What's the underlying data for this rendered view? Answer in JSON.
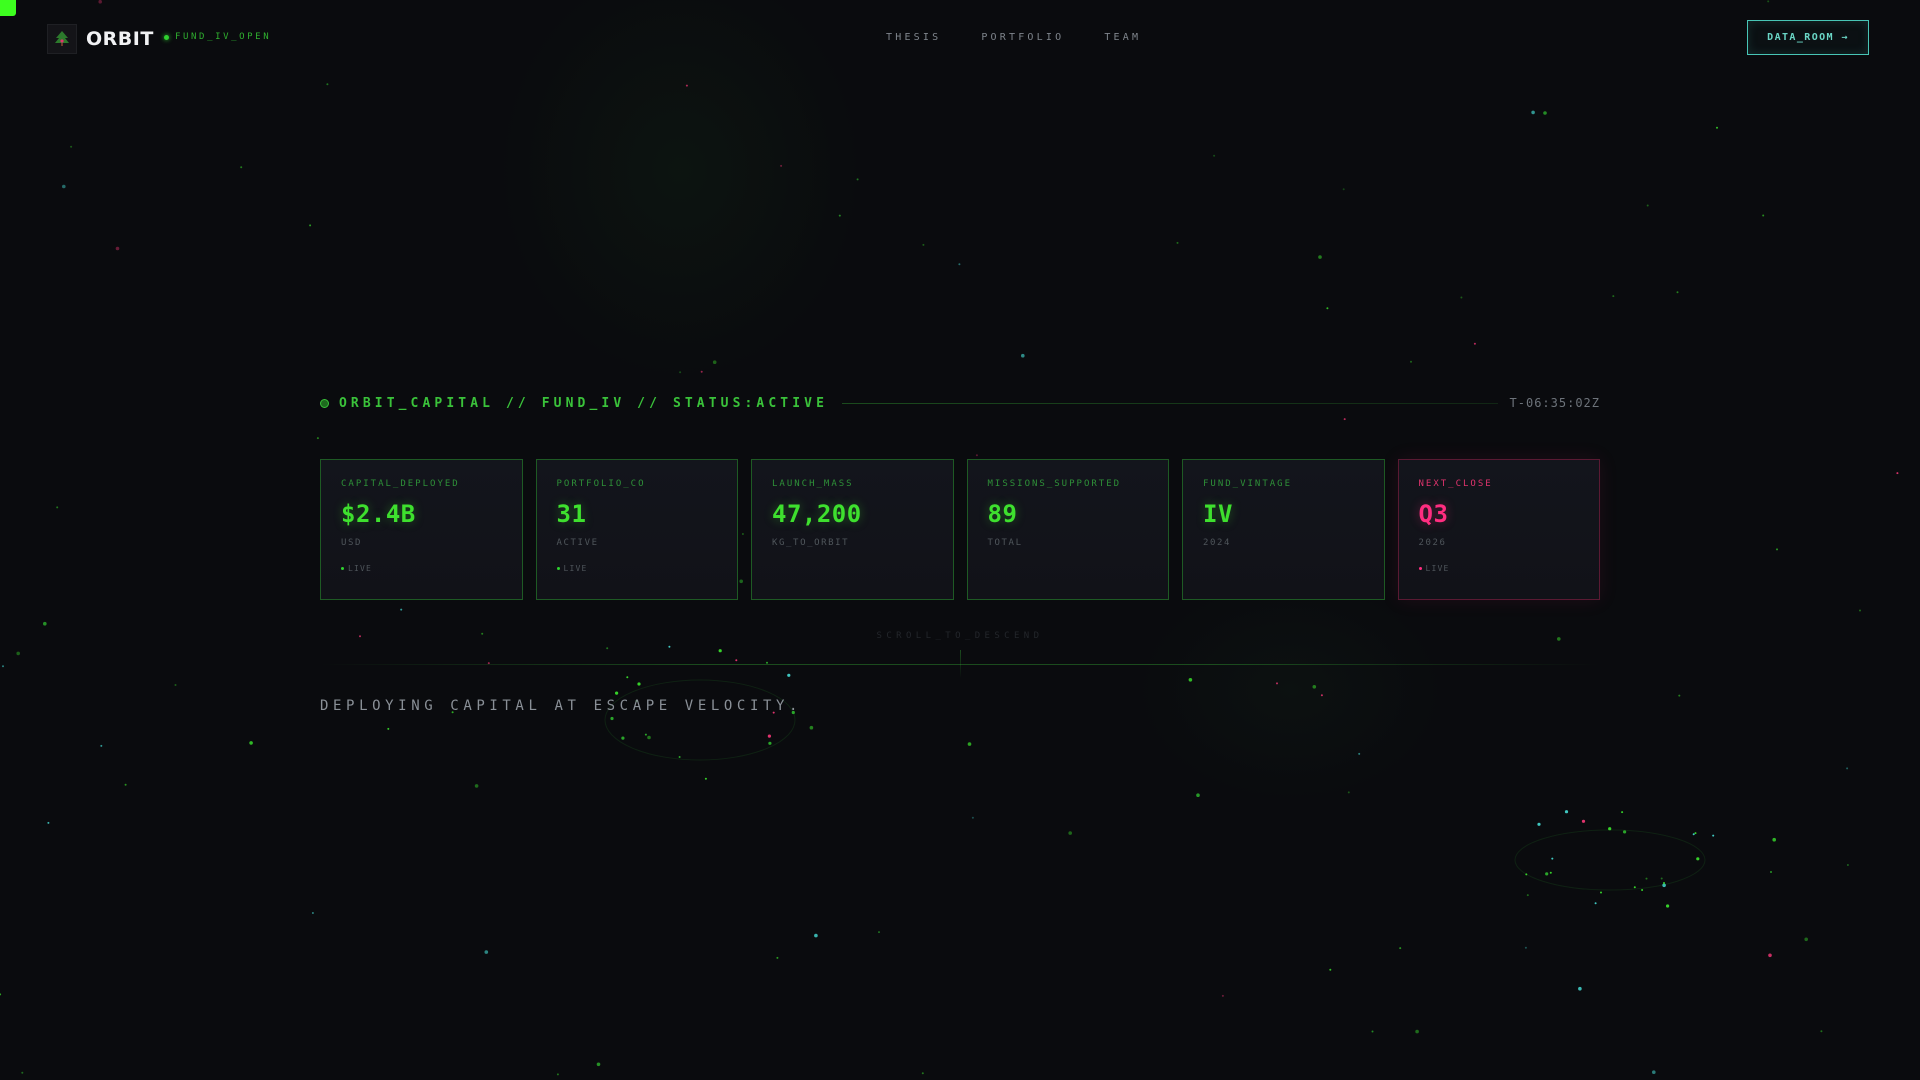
{
  "header": {
    "logo_text": "ORBIT",
    "fund_status": "FUND_IV_OPEN",
    "nav": [
      {
        "label": "THESIS"
      },
      {
        "label": "PORTFOLIO"
      },
      {
        "label": "TEAM"
      }
    ],
    "cta_label": "DATA_ROOM →"
  },
  "status_bar": {
    "text": "ORBIT_CAPITAL // FUND_IV // STATUS:ACTIVE",
    "timestamp": "T-06:35:02Z"
  },
  "stats": [
    {
      "label": "CAPITAL_DEPLOYED",
      "value": "$2.4B",
      "sub": "USD",
      "live": "LIVE"
    },
    {
      "label": "PORTFOLIO_CO",
      "value": "31",
      "sub": "ACTIVE",
      "live": "LIVE"
    },
    {
      "label": "LAUNCH_MASS",
      "value": "47,200",
      "sub": "KG_TO_ORBIT",
      "live": ""
    },
    {
      "label": "MISSIONS_SUPPORTED",
      "value": "89",
      "sub": "TOTAL",
      "live": ""
    },
    {
      "label": "FUND_VINTAGE",
      "value": "IV",
      "sub": "2024",
      "live": ""
    },
    {
      "label": "NEXT_CLOSE",
      "value": "Q3",
      "sub": "2026",
      "live": "LIVE"
    }
  ],
  "scroll_hint": "SCROLL_TO_DESCEND",
  "tagline": "DEPLOYING CAPITAL AT ESCAPE VELOCITY.",
  "colors": {
    "background": "#0a0b0e",
    "accent_green": "#3ee02e",
    "accent_pink": "#ff2d80",
    "accent_teal": "#48c5b6"
  },
  "icons": {
    "logo": "orbit-tree-icon",
    "status": "status-dot-icon"
  }
}
